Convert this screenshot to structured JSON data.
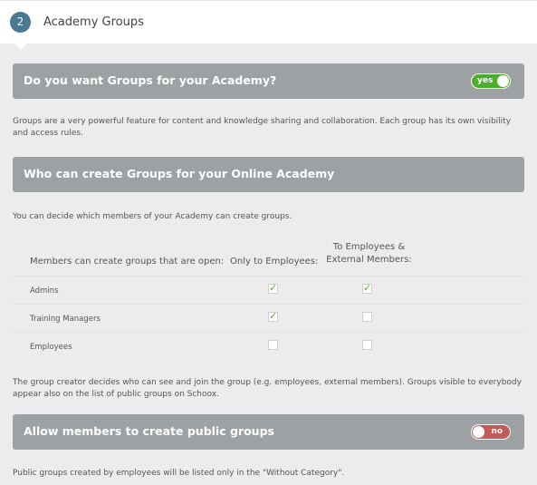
{
  "header": {
    "step_number": "2",
    "title": "Academy Groups"
  },
  "section_groups": {
    "title": "Do you want Groups for your Academy?",
    "toggle_state": "on",
    "toggle_label": "yes",
    "description": "Groups are a very powerful feature for content and knowledge sharing and collaboration. Each group has its own visibility and access rules."
  },
  "section_create": {
    "title": "Who can create Groups for your Online Academy",
    "description": "You can decide which members of your Academy can create groups."
  },
  "table": {
    "header_row_label": "Members can create groups that are open:",
    "col_employees": "Only to Employees:",
    "col_external_line1": "To Employees &",
    "col_external_line2": "External Members:",
    "rows": [
      {
        "label": "Admins",
        "employees": true,
        "external": true
      },
      {
        "label": "Training Managers",
        "employees": true,
        "external": false
      },
      {
        "label": "Employees",
        "employees": false,
        "external": false
      }
    ]
  },
  "visibility_note": "The group creator decides who can see and join the group (e.g. employees, external members). Groups visible to everybody appear also on the list of public groups on Schoox.",
  "section_public": {
    "title": "Allow members to create public groups",
    "toggle_state": "off",
    "toggle_label": "no",
    "description": "Public groups created by employees will be listed only in the \"Without Category\"."
  },
  "colors": {
    "accent": "#4a7a93",
    "section_bg": "#9ea1a3",
    "toggle_on": "#4caf2c",
    "toggle_off": "#c35a5a"
  }
}
